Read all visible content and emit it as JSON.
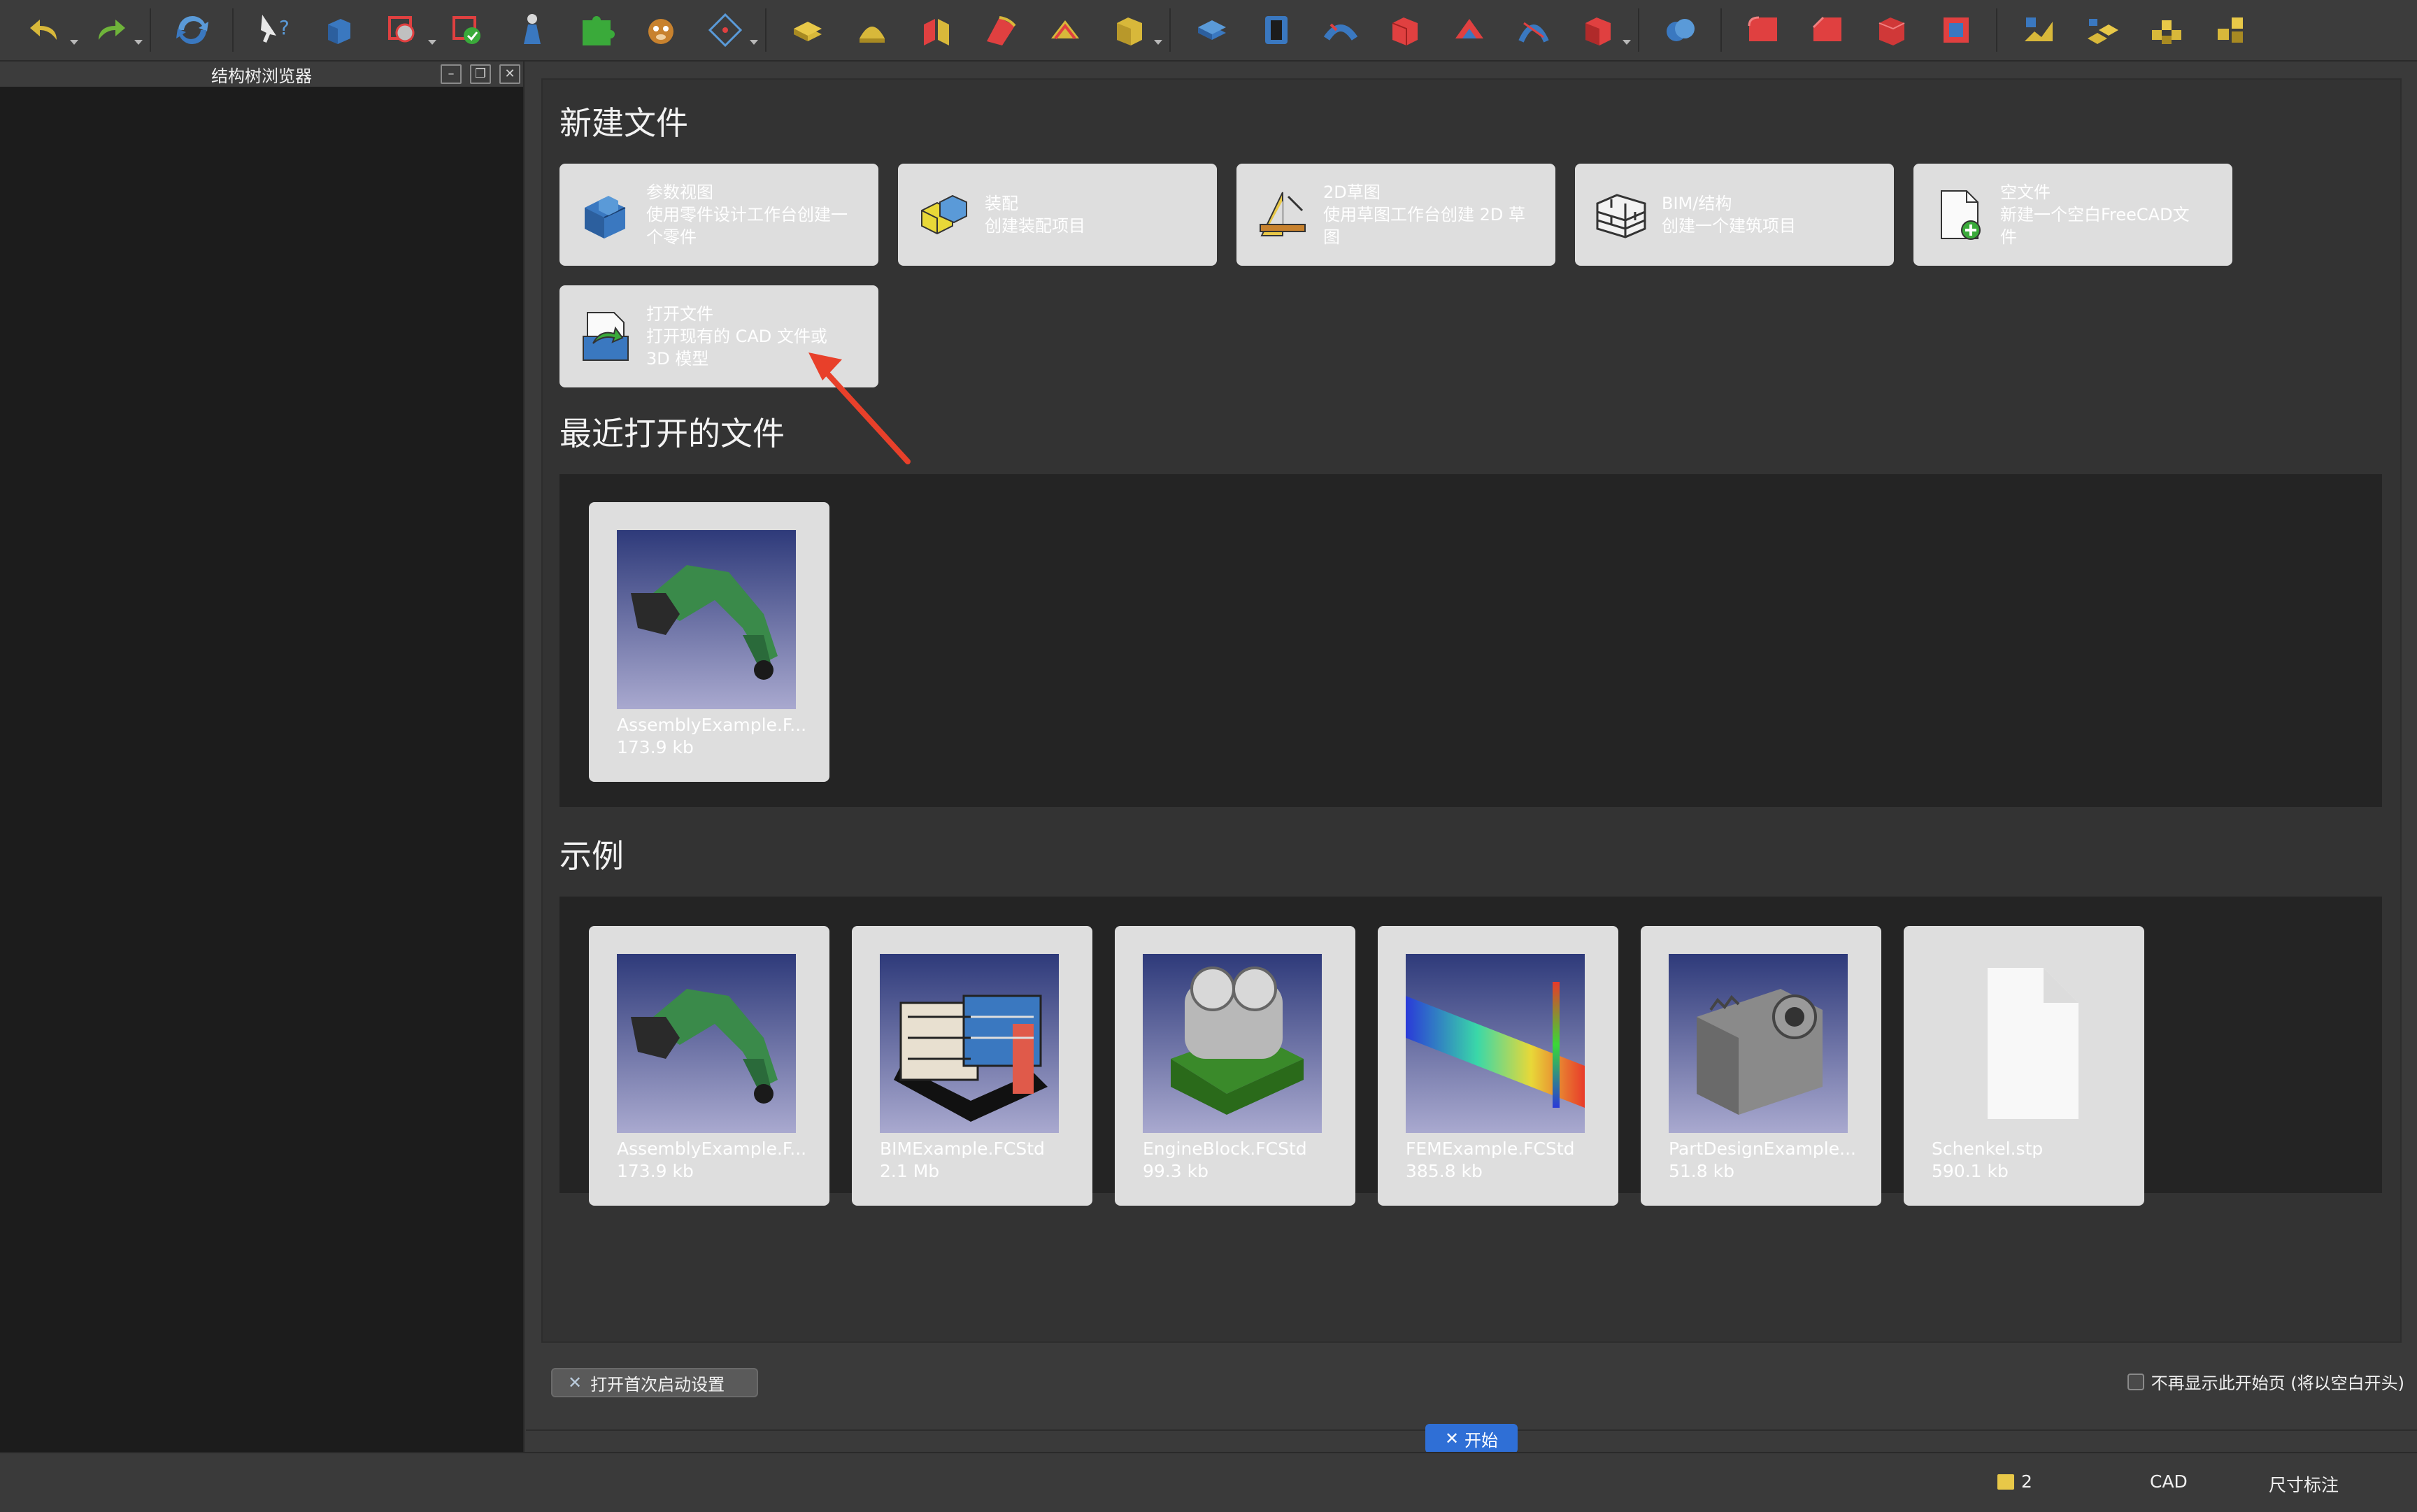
{
  "left_panel": {
    "title": "结构树浏览器"
  },
  "new_file": {
    "title": "新建文件",
    "cards": [
      {
        "title": "参数视图",
        "desc": "使用零件设计工作台创建一个零件"
      },
      {
        "title": "装配",
        "desc": "创建装配项目"
      },
      {
        "title": "2D草图",
        "desc": "使用草图工作台创建 2D 草图"
      },
      {
        "title": "BIM/结构",
        "desc": "创建一个建筑项目"
      },
      {
        "title": "空文件",
        "desc": "新建一个空白FreeCAD文件"
      },
      {
        "title": "打开文件",
        "desc": "打开现有的 CAD 文件或 3D 模型"
      }
    ]
  },
  "recent": {
    "title": "最近打开的文件",
    "files": [
      {
        "name": "AssemblyExample.F...",
        "size": "173.9 kb"
      }
    ]
  },
  "examples": {
    "title": "示例",
    "files": [
      {
        "name": "AssemblyExample.F...",
        "size": "173.9 kb"
      },
      {
        "name": "BIMExample.FCStd",
        "size": "2.1 Mb"
      },
      {
        "name": "EngineBlock.FCStd",
        "size": "99.3 kb"
      },
      {
        "name": "FEMExample.FCStd",
        "size": "385.8 kb"
      },
      {
        "name": "PartDesignExample....",
        "size": "51.8 kb"
      },
      {
        "name": "Schenkel.stp",
        "size": "590.1 kb"
      }
    ]
  },
  "footer": {
    "first_start_button": "打开首次启动设置",
    "dont_show_label": "不再显示此开始页 (将以空白开头)"
  },
  "tab": {
    "label": "开始"
  },
  "status": {
    "count": "2",
    "nav_style": "CAD",
    "units": "尺寸标注"
  },
  "colors": {
    "accent": "#2f6fd6",
    "annotation_arrow": "#e8402a"
  }
}
